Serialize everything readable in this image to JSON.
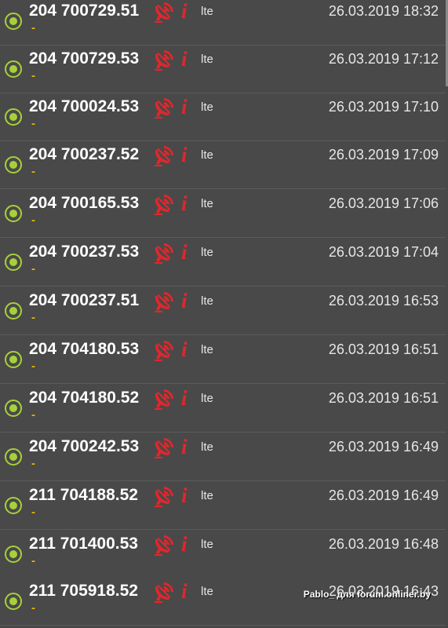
{
  "colors": {
    "background": "#494949",
    "radio_active": "#a6d13a",
    "info_icon": "#e3262b",
    "dash": "#e8b400",
    "text": "#ffffff"
  },
  "rows": [
    {
      "cell_id": "204 700729.51",
      "sub": "-",
      "tech": "lte",
      "datetime": "26.03.2019 18:32"
    },
    {
      "cell_id": "204 700729.53",
      "sub": "-",
      "tech": "lte",
      "datetime": "26.03.2019 17:12"
    },
    {
      "cell_id": "204 700024.53",
      "sub": "-",
      "tech": "lte",
      "datetime": "26.03.2019 17:10"
    },
    {
      "cell_id": "204 700237.52",
      "sub": "-",
      "tech": "lte",
      "datetime": "26.03.2019 17:09"
    },
    {
      "cell_id": "204 700165.53",
      "sub": "-",
      "tech": "lte",
      "datetime": "26.03.2019 17:06"
    },
    {
      "cell_id": "204 700237.53",
      "sub": "-",
      "tech": "lte",
      "datetime": "26.03.2019 17:04"
    },
    {
      "cell_id": "204 700237.51",
      "sub": "-",
      "tech": "lte",
      "datetime": "26.03.2019 16:53"
    },
    {
      "cell_id": "204 704180.53",
      "sub": "-",
      "tech": "lte",
      "datetime": "26.03.2019 16:51"
    },
    {
      "cell_id": "204 704180.52",
      "sub": "-",
      "tech": "lte",
      "datetime": "26.03.2019 16:51"
    },
    {
      "cell_id": "204 700242.53",
      "sub": "-",
      "tech": "lte",
      "datetime": "26.03.2019 16:49"
    },
    {
      "cell_id": "211 704188.52",
      "sub": "-",
      "tech": "lte",
      "datetime": "26.03.2019 16:49"
    },
    {
      "cell_id": "211 701400.53",
      "sub": "-",
      "tech": "lte",
      "datetime": "26.03.2019 16:48"
    },
    {
      "cell_id": "211 705918.52",
      "sub": "-",
      "tech": "lte",
      "datetime": "26.03.2019 16:43"
    }
  ],
  "icons": {
    "status": "radio-selected-icon",
    "antenna": "satellite-dish-icon",
    "info": "info-icon"
  },
  "info_glyph": "i",
  "watermark": "Pablo_ для forum.onliner.by"
}
